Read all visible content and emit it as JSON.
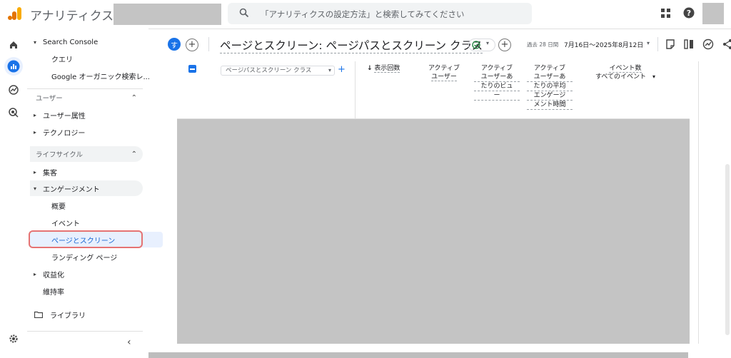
{
  "app": {
    "title": "アナリティクス"
  },
  "search": {
    "placeholder": "「アナリティクスの設定方法」と検索してみてください"
  },
  "sidebar": {
    "search_console": "Search Console",
    "query": "クエリ",
    "google_organic": "Google オーガニック検索レ...",
    "section_user": "ユーザー",
    "user_attributes": "ユーザー属性",
    "technology": "テクノロジー",
    "section_lifecycle": "ライフサイクル",
    "acquisition": "集客",
    "engagement": "エンゲージメント",
    "overview": "概要",
    "events": "イベント",
    "pages_screens": "ページとスクリーン",
    "landing_page": "ランディング ページ",
    "monetization": "収益化",
    "retention": "維持率",
    "library": "ライブラリ"
  },
  "header": {
    "badge": "す",
    "report_title": "ページとスクリーン: ページパスとスクリーン クラス",
    "date_label": "過去 28 日間",
    "date_range": "7月16日～2025年8月12日"
  },
  "table": {
    "dimension": "ページパスとスクリーン クラス",
    "col_views": "表示回数",
    "col_active_users": [
      "アクティブ",
      "ユーザー"
    ],
    "col_views_per_user": [
      "アクティブ",
      "ユーザーあ",
      "たりのビュ",
      "ー"
    ],
    "col_avg_engagement": [
      "アクティブ",
      "ユーザーあ",
      "たりの平均",
      "エンゲージ",
      "メント時間"
    ],
    "col_event_count": "イベント数",
    "col_all_events": "すべてのイベント"
  },
  "colors": {
    "accent": "#1a73e8",
    "highlight": "#e57373",
    "logo_orange": "#f9ab00",
    "logo_dark": "#e37400"
  }
}
